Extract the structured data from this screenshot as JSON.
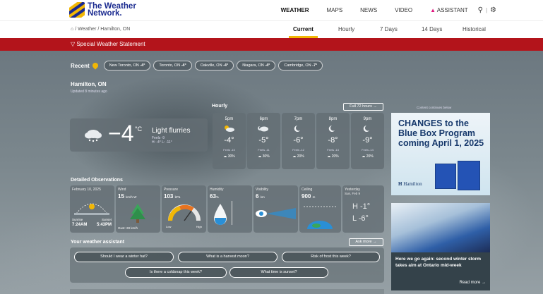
{
  "header": {
    "logo_line1": "The Weather",
    "logo_line2": "Network.",
    "nav": [
      "WEATHER",
      "MAPS",
      "NEWS",
      "VIDEO"
    ],
    "assistant": "ASSISTANT",
    "divider": "|"
  },
  "breadcrumb": "/ Weather / Hamilton, ON",
  "tabs": [
    "Current",
    "Hourly",
    "7 Days",
    "14 Days",
    "Historical"
  ],
  "alert": "Special Weather Statement",
  "recent": {
    "label": "Recent",
    "chips": [
      {
        "name": "New Toronto, ON",
        "temp": "-4°"
      },
      {
        "name": "Toronto, ON",
        "temp": "-4°"
      },
      {
        "name": "Oakville, ON",
        "temp": "-4°"
      },
      {
        "name": "Niagara, ON",
        "temp": "-4°"
      },
      {
        "name": "Cambridge, ON",
        "temp": "-7°"
      }
    ]
  },
  "location": {
    "city": "Hamilton, ON",
    "updated": "Updated 8 minutes ago"
  },
  "current": {
    "temp": "−4",
    "unit": "°C",
    "condition": "Light flurries",
    "feels": "Feels -9",
    "hilo": "H: -4°  L: -11°"
  },
  "hourly": {
    "title": "Hourly",
    "full_label": "Full 72 hours →",
    "hours": [
      {
        "time": "5pm",
        "temp": "-4°",
        "feels": "Feels -10",
        "pop": "30%"
      },
      {
        "time": "6pm",
        "temp": "-5°",
        "feels": "Feels -11",
        "pop": "30%"
      },
      {
        "time": "7pm",
        "temp": "-6°",
        "feels": "Feels -12",
        "pop": "20%"
      },
      {
        "time": "8pm",
        "temp": "-8°",
        "feels": "Feels -13",
        "pop": "20%"
      },
      {
        "time": "9pm",
        "temp": "-9°",
        "feels": "Feels -14",
        "pop": "20%"
      }
    ]
  },
  "ad": {
    "note": "Content continues below",
    "headline": "CHANGES to the Blue Box Program coming April 1, 2025",
    "brand": "Hamilton"
  },
  "news": {
    "headline": "Here we go again: second winter storm takes aim at Ontario mid-week",
    "read_more": "Read more →"
  },
  "observations": {
    "title": "Detailed Observations",
    "date": "February 10, 2025",
    "sunrise_label": "Sunrise",
    "sunset_label": "Sunset",
    "sunrise": "7:24AM",
    "sunset": "5:43PM",
    "wind_label": "Wind",
    "wind": "15",
    "wind_unit": "km/h W",
    "gust": "Gust: 28 km/h",
    "pressure_label": "Pressure",
    "pressure": "103",
    "pressure_unit": "kPa",
    "pressure_low": "Low",
    "pressure_high": "High",
    "humidity_label": "Humidity",
    "humidity": "63",
    "humidity_unit": "%",
    "visibility_label": "Visibility",
    "visibility": "6",
    "visibility_unit": "km",
    "ceiling_label": "Ceiling",
    "ceiling": "900",
    "ceiling_unit": "m",
    "yesterday_label": "Yesterday",
    "yesterday_date": "Sun, Feb 9",
    "yesterday_high": "H -1°",
    "yesterday_low": "L -6°"
  },
  "assistant": {
    "title": "Your weather assistant",
    "ask_more": "Ask more →",
    "questions": [
      "Should I wear a winter hat?",
      "What is a harvest moon?",
      "Risk of frost this week?",
      "Is there a coldsnap this week?",
      "What time is sunset?"
    ]
  },
  "colors": {
    "accent": "#f2b705",
    "alert": "#b3141b",
    "brand": "#1a2a8f"
  }
}
